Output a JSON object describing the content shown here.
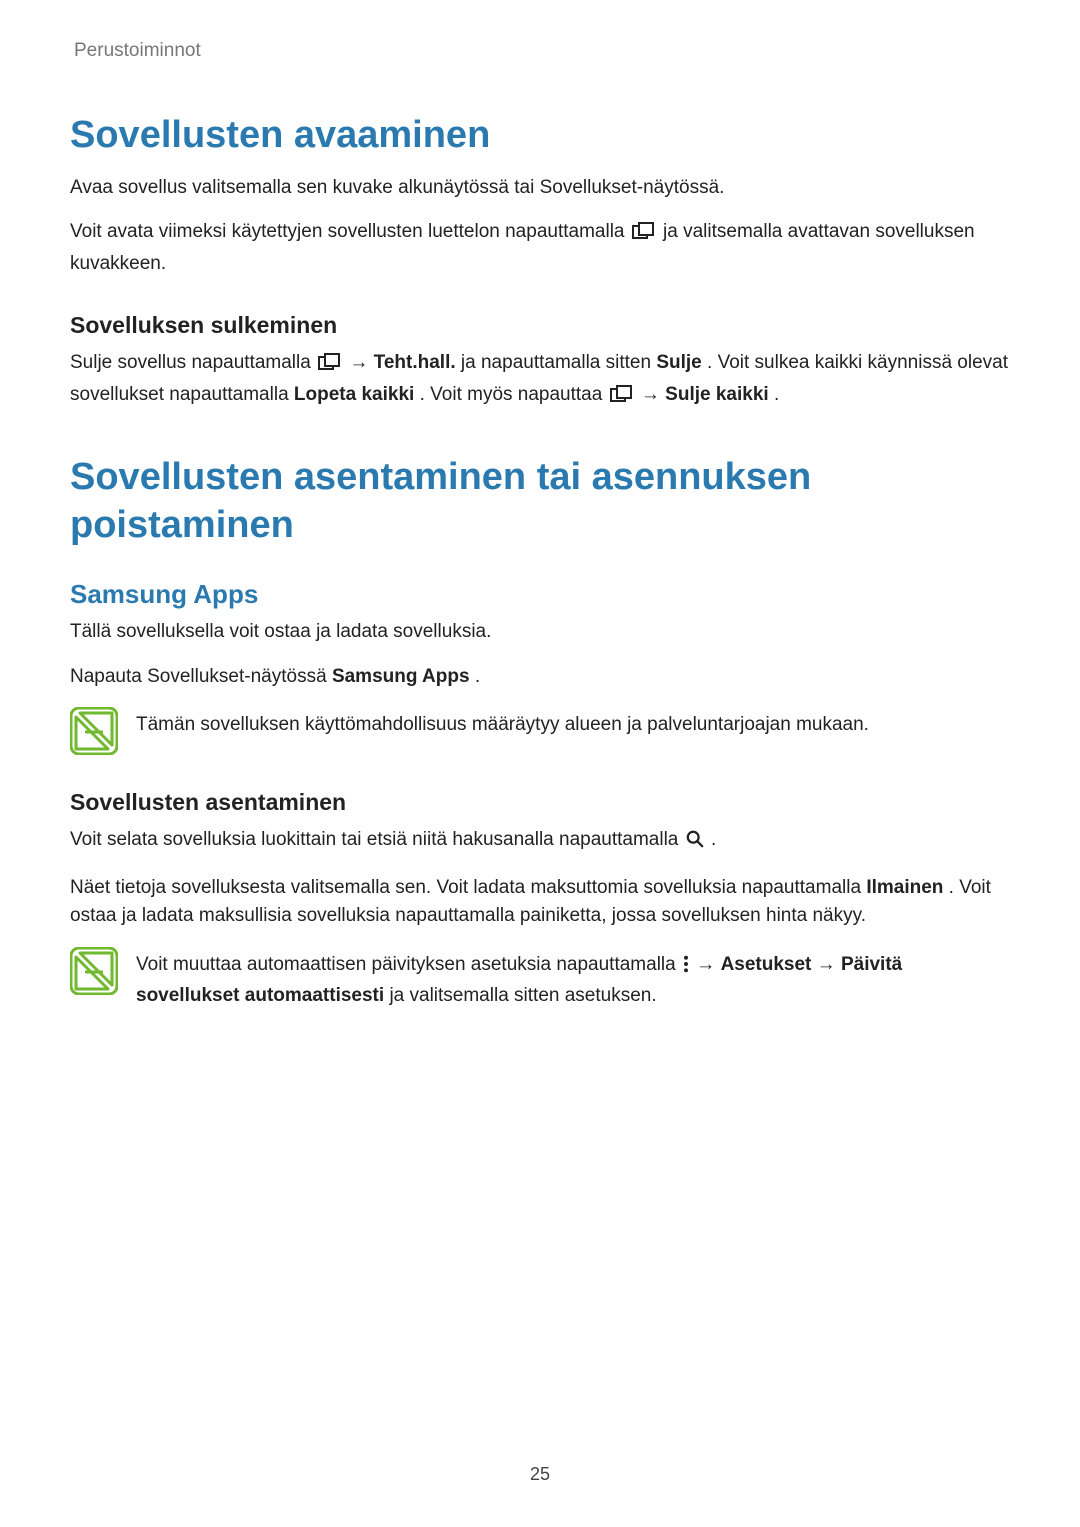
{
  "header": {
    "section": "Perustoiminnot"
  },
  "sec1": {
    "title": "Sovellusten avaaminen",
    "p1a": "Avaa sovellus valitsemalla sen kuvake alkunäytössä tai Sovellukset-näytössä.",
    "p1b_pre": "Voit avata viimeksi käytettyjen sovellusten luettelon napauttamalla ",
    "p1b_post": " ja valitsemalla avattavan sovelluksen kuvakkeen.",
    "sub": {
      "title": "Sovelluksen sulkeminen",
      "p_pre": "Sulje sovellus napauttamalla ",
      "arrow1": " → ",
      "tehthall": "Teht.hall.",
      "mid1": " ja napauttamalla sitten ",
      "sulje": "Sulje",
      "mid2": ". Voit sulkea kaikki käynnissä olevat sovellukset napauttamalla ",
      "lopeta": "Lopeta kaikki",
      "mid3": ". Voit myös napauttaa ",
      "arrow2": " → ",
      "suljekaikki": "Sulje kaikki",
      "end": "."
    }
  },
  "sec2": {
    "title": "Sovellusten asentaminen tai asennuksen poistaminen",
    "samsungApps": {
      "title": "Samsung Apps",
      "p1": "Tällä sovelluksella voit ostaa ja ladata sovelluksia.",
      "p2_pre": "Napauta Sovellukset-näytössä ",
      "p2_bold": "Samsung Apps",
      "p2_end": ".",
      "note": "Tämän sovelluksen käyttömahdollisuus määräytyy alueen ja palveluntarjoajan mukaan."
    },
    "install": {
      "title": "Sovellusten asentaminen",
      "p1_pre": "Voit selata sovelluksia luokittain tai etsiä niitä hakusanalla napauttamalla ",
      "p1_end": ".",
      "p2_pre": "Näet tietoja sovelluksesta valitsemalla sen. Voit ladata maksuttomia sovelluksia napauttamalla ",
      "p2_ilmainen": "Ilmainen",
      "p2_post": ". Voit ostaa ja ladata maksullisia sovelluksia napauttamalla painiketta, jossa sovelluksen hinta näkyy.",
      "note_pre": "Voit muuttaa automaattisen päivityksen asetuksia napauttamalla ",
      "note_arrow1": " → ",
      "note_asetukset": "Asetukset",
      "note_arrow2": " → ",
      "note_paivita": "Päivitä sovellukset automaattisesti",
      "note_post": " ja valitsemalla sitten asetuksen."
    }
  },
  "pageNumber": "25"
}
